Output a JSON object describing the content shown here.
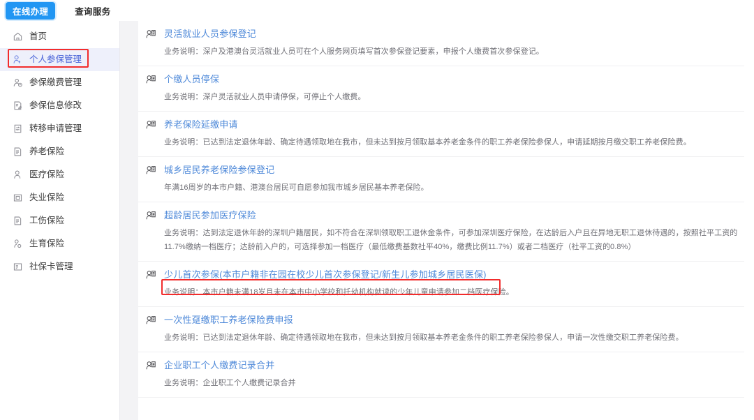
{
  "topbar": {
    "tabs": [
      {
        "label": "在线办理",
        "active": true
      },
      {
        "label": "查询服务",
        "active": false
      }
    ]
  },
  "sidebar": {
    "items": [
      {
        "label": "首页",
        "icon": "home-icon",
        "selected": false
      },
      {
        "label": "个人参保管理",
        "icon": "user-shield-icon",
        "selected": true
      },
      {
        "label": "参保缴费管理",
        "icon": "user-payment-icon",
        "selected": false
      },
      {
        "label": "参保信息修改",
        "icon": "document-edit-icon",
        "selected": false
      },
      {
        "label": "转移申请管理",
        "icon": "transfer-icon",
        "selected": false
      },
      {
        "label": "养老保险",
        "icon": "document-icon",
        "selected": false
      },
      {
        "label": "医疗保险",
        "icon": "person-icon",
        "selected": false
      },
      {
        "label": "失业保险",
        "icon": "box-icon",
        "selected": false
      },
      {
        "label": "工伤保险",
        "icon": "document-icon",
        "selected": false
      },
      {
        "label": "生育保险",
        "icon": "baby-icon",
        "selected": false
      },
      {
        "label": "社保卡管理",
        "icon": "card-icon",
        "selected": false
      }
    ]
  },
  "main": {
    "services": [
      {
        "title": "灵活就业人员参保登记",
        "desc": "业务说明：深户及港澳台灵活就业人员可在个人服务网页填写首次参保登记要素，申报个人缴费首次参保登记。",
        "highlighted": false
      },
      {
        "title": "个缴人员停保",
        "desc": "业务说明：深户灵活就业人员申请停保，可停止个人缴费。",
        "highlighted": false
      },
      {
        "title": "养老保险延缴申请",
        "desc": "业务说明：已达到法定退休年龄、确定待遇领取地在我市，但未达到按月领取基本养老金条件的职工养老保险参保人，申请延期按月缴交职工养老保险费。",
        "highlighted": false
      },
      {
        "title": "城乡居民养老保险参保登记",
        "desc": "年满16周岁的本市户籍、港澳台居民可自愿参加我市城乡居民基本养老保险。",
        "highlighted": false
      },
      {
        "title": "超龄居民参加医疗保险",
        "desc": "业务说明：达到法定退休年龄的深圳户籍居民，如不符合在深圳领取职工退休金条件，可参加深圳医疗保险，在达龄后入户且在异地无职工退休待遇的，按照社平工资的11.7%缴纳一档医疗；达龄前入户的，可选择参加一档医疗（最低缴费基数社平40%，缴费比例11.7%）或者二档医疗（社平工资的0.8%）",
        "highlighted": false
      },
      {
        "title": "少儿首次参保(本市户籍非在园在校少儿首次参保登记/新生儿参加城乡居民医保)",
        "desc": "业务说明：本市户籍未满18岁且未在本市中小学校和托幼机构就读的少年儿童申请参加二档医疗保险。",
        "highlighted": true
      },
      {
        "title": "一次性趸缴职工养老保险费申报",
        "desc": "业务说明：已达到法定退休年龄、确定待遇领取地在我市，但未达到按月领取基本养老金条件的职工养老保险参保人，申请一次性缴交职工养老保险费。",
        "highlighted": false
      },
      {
        "title": "企业职工个人缴费记录合并",
        "desc": "业务说明：企业职工个人缴费记录合并",
        "highlighted": false
      }
    ]
  },
  "annotations": {
    "color": "#f22c2c",
    "boxes": [
      "sidebar-selected-item",
      "child-first-enrollment-service"
    ]
  }
}
